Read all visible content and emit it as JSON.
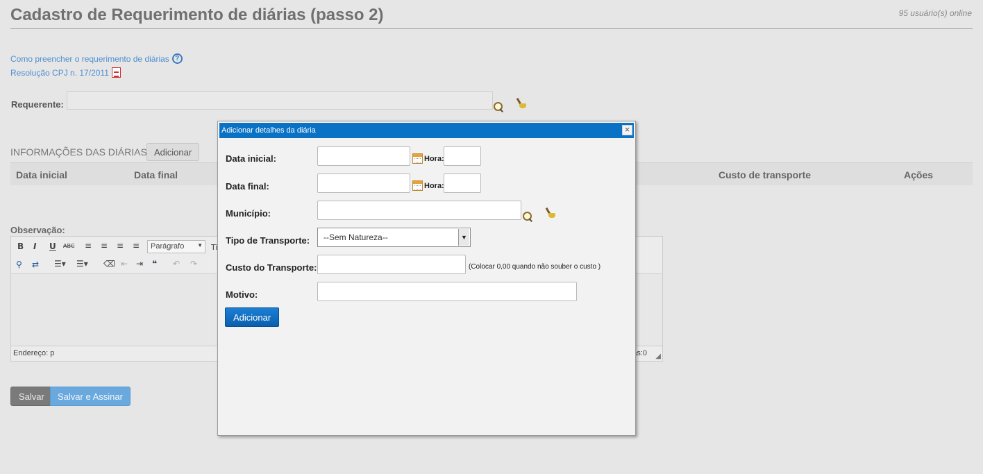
{
  "page": {
    "title": "Cadastro de Requerimento de diárias (passo 2)",
    "users_online": "95 usuário(s) online",
    "links": {
      "how_to": "Como preencher o requerimento de diárias",
      "resolution": "Resolução CPJ n. 17/2011"
    },
    "requerente_label": "Requerente:",
    "section_title": "INFORMAÇÕES DAS DIÁRIAS",
    "add_button": "Adicionar",
    "table_columns": [
      "Data inicial",
      "Data final",
      "Custo de transporte",
      "Ações"
    ],
    "observacao_label": "Observação:",
    "editor": {
      "format_select": "Parágrafo",
      "font_select_partial": "Ti",
      "status_path": "Endereço: p",
      "status_count_partial": "as:0"
    },
    "save_button": "Salvar",
    "save_sign_button": "Salvar e Assinar"
  },
  "modal": {
    "title": "Adicionar detalhes da diária",
    "close_glyph": "×",
    "fields": {
      "data_inicial": "Data inicial:",
      "data_final": "Data final:",
      "hora": "Hora:",
      "municipio": "Município:",
      "tipo_transporte": "Tipo de Transporte:",
      "custo_transporte": "Custo do Transporte:",
      "motivo": "Motivo:"
    },
    "transport_selected": "--Sem Natureza--",
    "cost_hint": "(Colocar 0,00 quando não souber o custo )",
    "submit_button": "Adicionar"
  }
}
